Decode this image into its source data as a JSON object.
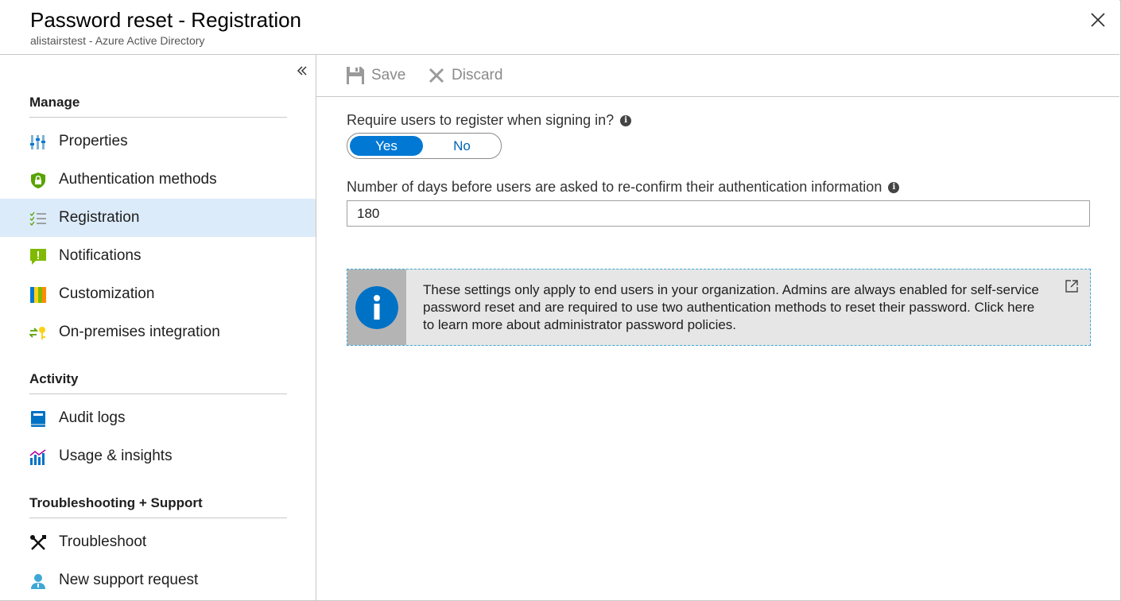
{
  "header": {
    "title": "Password reset - Registration",
    "subtitle": "alistairstest - Azure Active Directory"
  },
  "sidebar": {
    "sections": [
      {
        "title": "Manage",
        "items": [
          {
            "label": "Properties",
            "icon": "properties-icon"
          },
          {
            "label": "Authentication methods",
            "icon": "shield-lock-icon"
          },
          {
            "label": "Registration",
            "icon": "checklist-icon",
            "active": true
          },
          {
            "label": "Notifications",
            "icon": "notification-icon"
          },
          {
            "label": "Customization",
            "icon": "customization-icon"
          },
          {
            "label": "On-premises integration",
            "icon": "on-premises-icon"
          }
        ]
      },
      {
        "title": "Activity",
        "items": [
          {
            "label": "Audit logs",
            "icon": "book-icon"
          },
          {
            "label": "Usage & insights",
            "icon": "chart-icon"
          }
        ]
      },
      {
        "title": "Troubleshooting + Support",
        "items": [
          {
            "label": "Troubleshoot",
            "icon": "tools-icon"
          },
          {
            "label": "New support request",
            "icon": "support-person-icon"
          }
        ]
      }
    ]
  },
  "toolbar": {
    "save_label": "Save",
    "discard_label": "Discard"
  },
  "form": {
    "require_register_label": "Require users to register when signing in?",
    "toggle_yes": "Yes",
    "toggle_no": "No",
    "toggle_selected": "Yes",
    "days_label": "Number of days before users are asked to re-confirm their authentication information",
    "days_value": "180"
  },
  "info_banner": {
    "text": "These settings only apply to end users in your organization. Admins are always enabled for self-service password reset and are required to use two authentication methods to reset their password. Click here to learn more about administrator password policies."
  },
  "colors": {
    "accent": "#0078d4",
    "active_nav_bg": "#dcebf9",
    "info_blue": "#0072c6"
  }
}
